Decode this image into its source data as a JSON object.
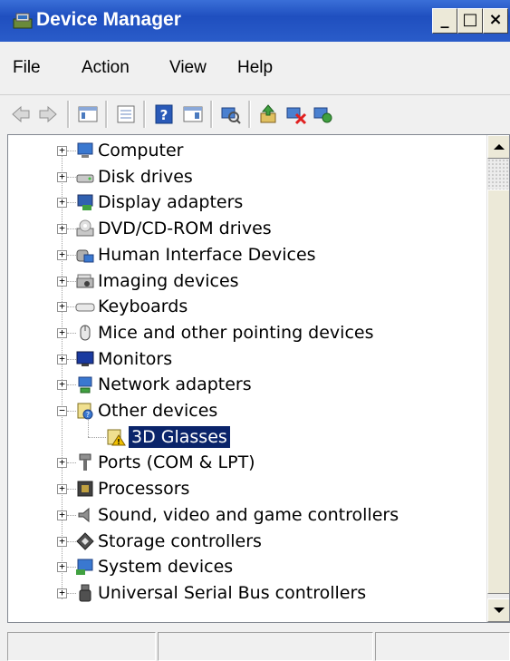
{
  "window": {
    "title": "Device Manager",
    "minimize_glyph": "_",
    "maximize_glyph": "□",
    "close_glyph": "×"
  },
  "menu": {
    "items": [
      "File",
      "Action",
      "View",
      "Help"
    ]
  },
  "toolbar": {
    "buttons": [
      "back-icon",
      "forward-icon",
      "show-hide-console-tree-icon",
      "properties-icon",
      "help-icon",
      "action-pane-icon",
      "scan-hardware-icon",
      "update-driver-icon",
      "uninstall-icon",
      "enable-device-icon"
    ]
  },
  "tree": {
    "nodes": [
      {
        "label": "Computer",
        "icon": "computer-icon",
        "expanded": false
      },
      {
        "label": "Disk drives",
        "icon": "disk-drive-icon",
        "expanded": false
      },
      {
        "label": "Display adapters",
        "icon": "display-adapter-icon",
        "expanded": false
      },
      {
        "label": "DVD/CD-ROM drives",
        "icon": "dvd-drive-icon",
        "expanded": false
      },
      {
        "label": "Human Interface Devices",
        "icon": "hid-icon",
        "expanded": false
      },
      {
        "label": "Imaging devices",
        "icon": "imaging-device-icon",
        "expanded": false
      },
      {
        "label": "Keyboards",
        "icon": "keyboard-icon",
        "expanded": false
      },
      {
        "label": "Mice and other pointing devices",
        "icon": "mouse-icon",
        "expanded": false
      },
      {
        "label": "Monitors",
        "icon": "monitor-icon",
        "expanded": false
      },
      {
        "label": "Network adapters",
        "icon": "network-adapter-icon",
        "expanded": false
      },
      {
        "label": "Other devices",
        "icon": "other-device-icon",
        "expanded": true,
        "children": [
          {
            "label": "3D Glasses",
            "icon": "unknown-device-warning-icon",
            "selected": true
          }
        ]
      },
      {
        "label": "Ports (COM & LPT)",
        "icon": "port-icon",
        "expanded": false
      },
      {
        "label": "Processors",
        "icon": "processor-icon",
        "expanded": false
      },
      {
        "label": "Sound, video and game controllers",
        "icon": "sound-icon",
        "expanded": false
      },
      {
        "label": "Storage controllers",
        "icon": "storage-controller-icon",
        "expanded": false
      },
      {
        "label": "System devices",
        "icon": "system-device-icon",
        "expanded": false
      },
      {
        "label": "Universal Serial Bus controllers",
        "icon": "usb-icon",
        "expanded": false
      }
    ]
  },
  "colors": {
    "titlebar": "#2a5cc9",
    "selection": "#0a246a",
    "window_bg": "#f0f0f0"
  },
  "statusbar": {
    "panes": [
      "",
      "",
      ""
    ]
  }
}
